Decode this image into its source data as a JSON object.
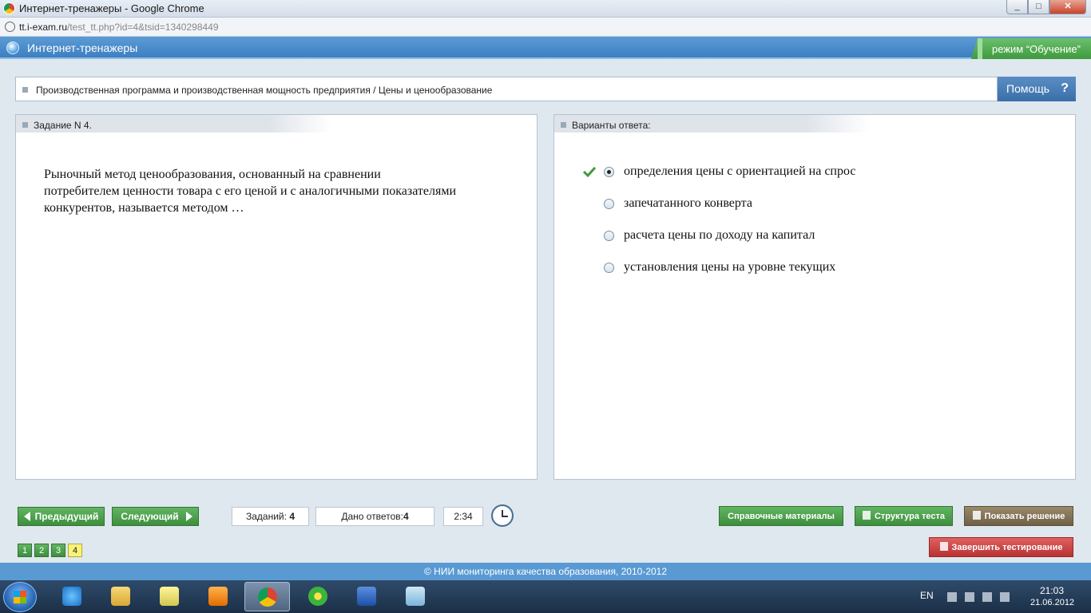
{
  "browser": {
    "window_title": "Интернет-тренажеры - Google Chrome",
    "url_host": "tt.i-exam.ru",
    "url_path": "/test_tt.php?id=4&tsid=1340298449",
    "min": "_",
    "max": "□",
    "close": "✕"
  },
  "app": {
    "name": "Интернет-тренажеры",
    "mode": "режим “Обучение”"
  },
  "topic": {
    "breadcrumb": "Производственная программа и производственная мощность предприятия / Цены и ценообразование",
    "help_label": "Помощь",
    "help_icon": "?"
  },
  "task": {
    "header": "Задание N 4.",
    "text": "Рыночный метод ценообразования, основанный на сравнении потребителем ценности товара с его ценой и с аналогичными показателями конкурентов, называется методом …"
  },
  "answers": {
    "header": "Варианты ответа:",
    "options": [
      {
        "label": "определения цены с ориентацией на спрос",
        "selected": true,
        "correct_mark": true
      },
      {
        "label": "запечатанного конверта",
        "selected": false,
        "correct_mark": false
      },
      {
        "label": "расчета цены по доходу на капитал",
        "selected": false,
        "correct_mark": false
      },
      {
        "label": "установления цены на уровне текущих",
        "selected": false,
        "correct_mark": false
      }
    ]
  },
  "nav": {
    "prev": "Предыдущий",
    "next": "Следующий",
    "tasks_label": "Заданий:",
    "tasks_count": "4",
    "answered_label": "Дано ответов:",
    "answered_count": "4",
    "timer": "2:34",
    "pages": [
      "1",
      "2",
      "3",
      "4"
    ],
    "current_page": "4"
  },
  "actions": {
    "reference": "Справочные материалы",
    "structure": "Структура теста",
    "show_solution": "Показать решение",
    "finish": "Завершить тестирование"
  },
  "footer": {
    "copyright": "© НИИ мониторинга качества образования, 2010-2012"
  },
  "taskbar": {
    "lang": "EN",
    "time": "21:03",
    "date": "21.06.2012"
  },
  "colors": {
    "header_blue": "#4a8ccb",
    "button_green": "#4a9e4a",
    "footer_blue": "#5a9ad3",
    "current_page_yellow": "#f7f27a",
    "finish_red": "#c83c3c"
  }
}
